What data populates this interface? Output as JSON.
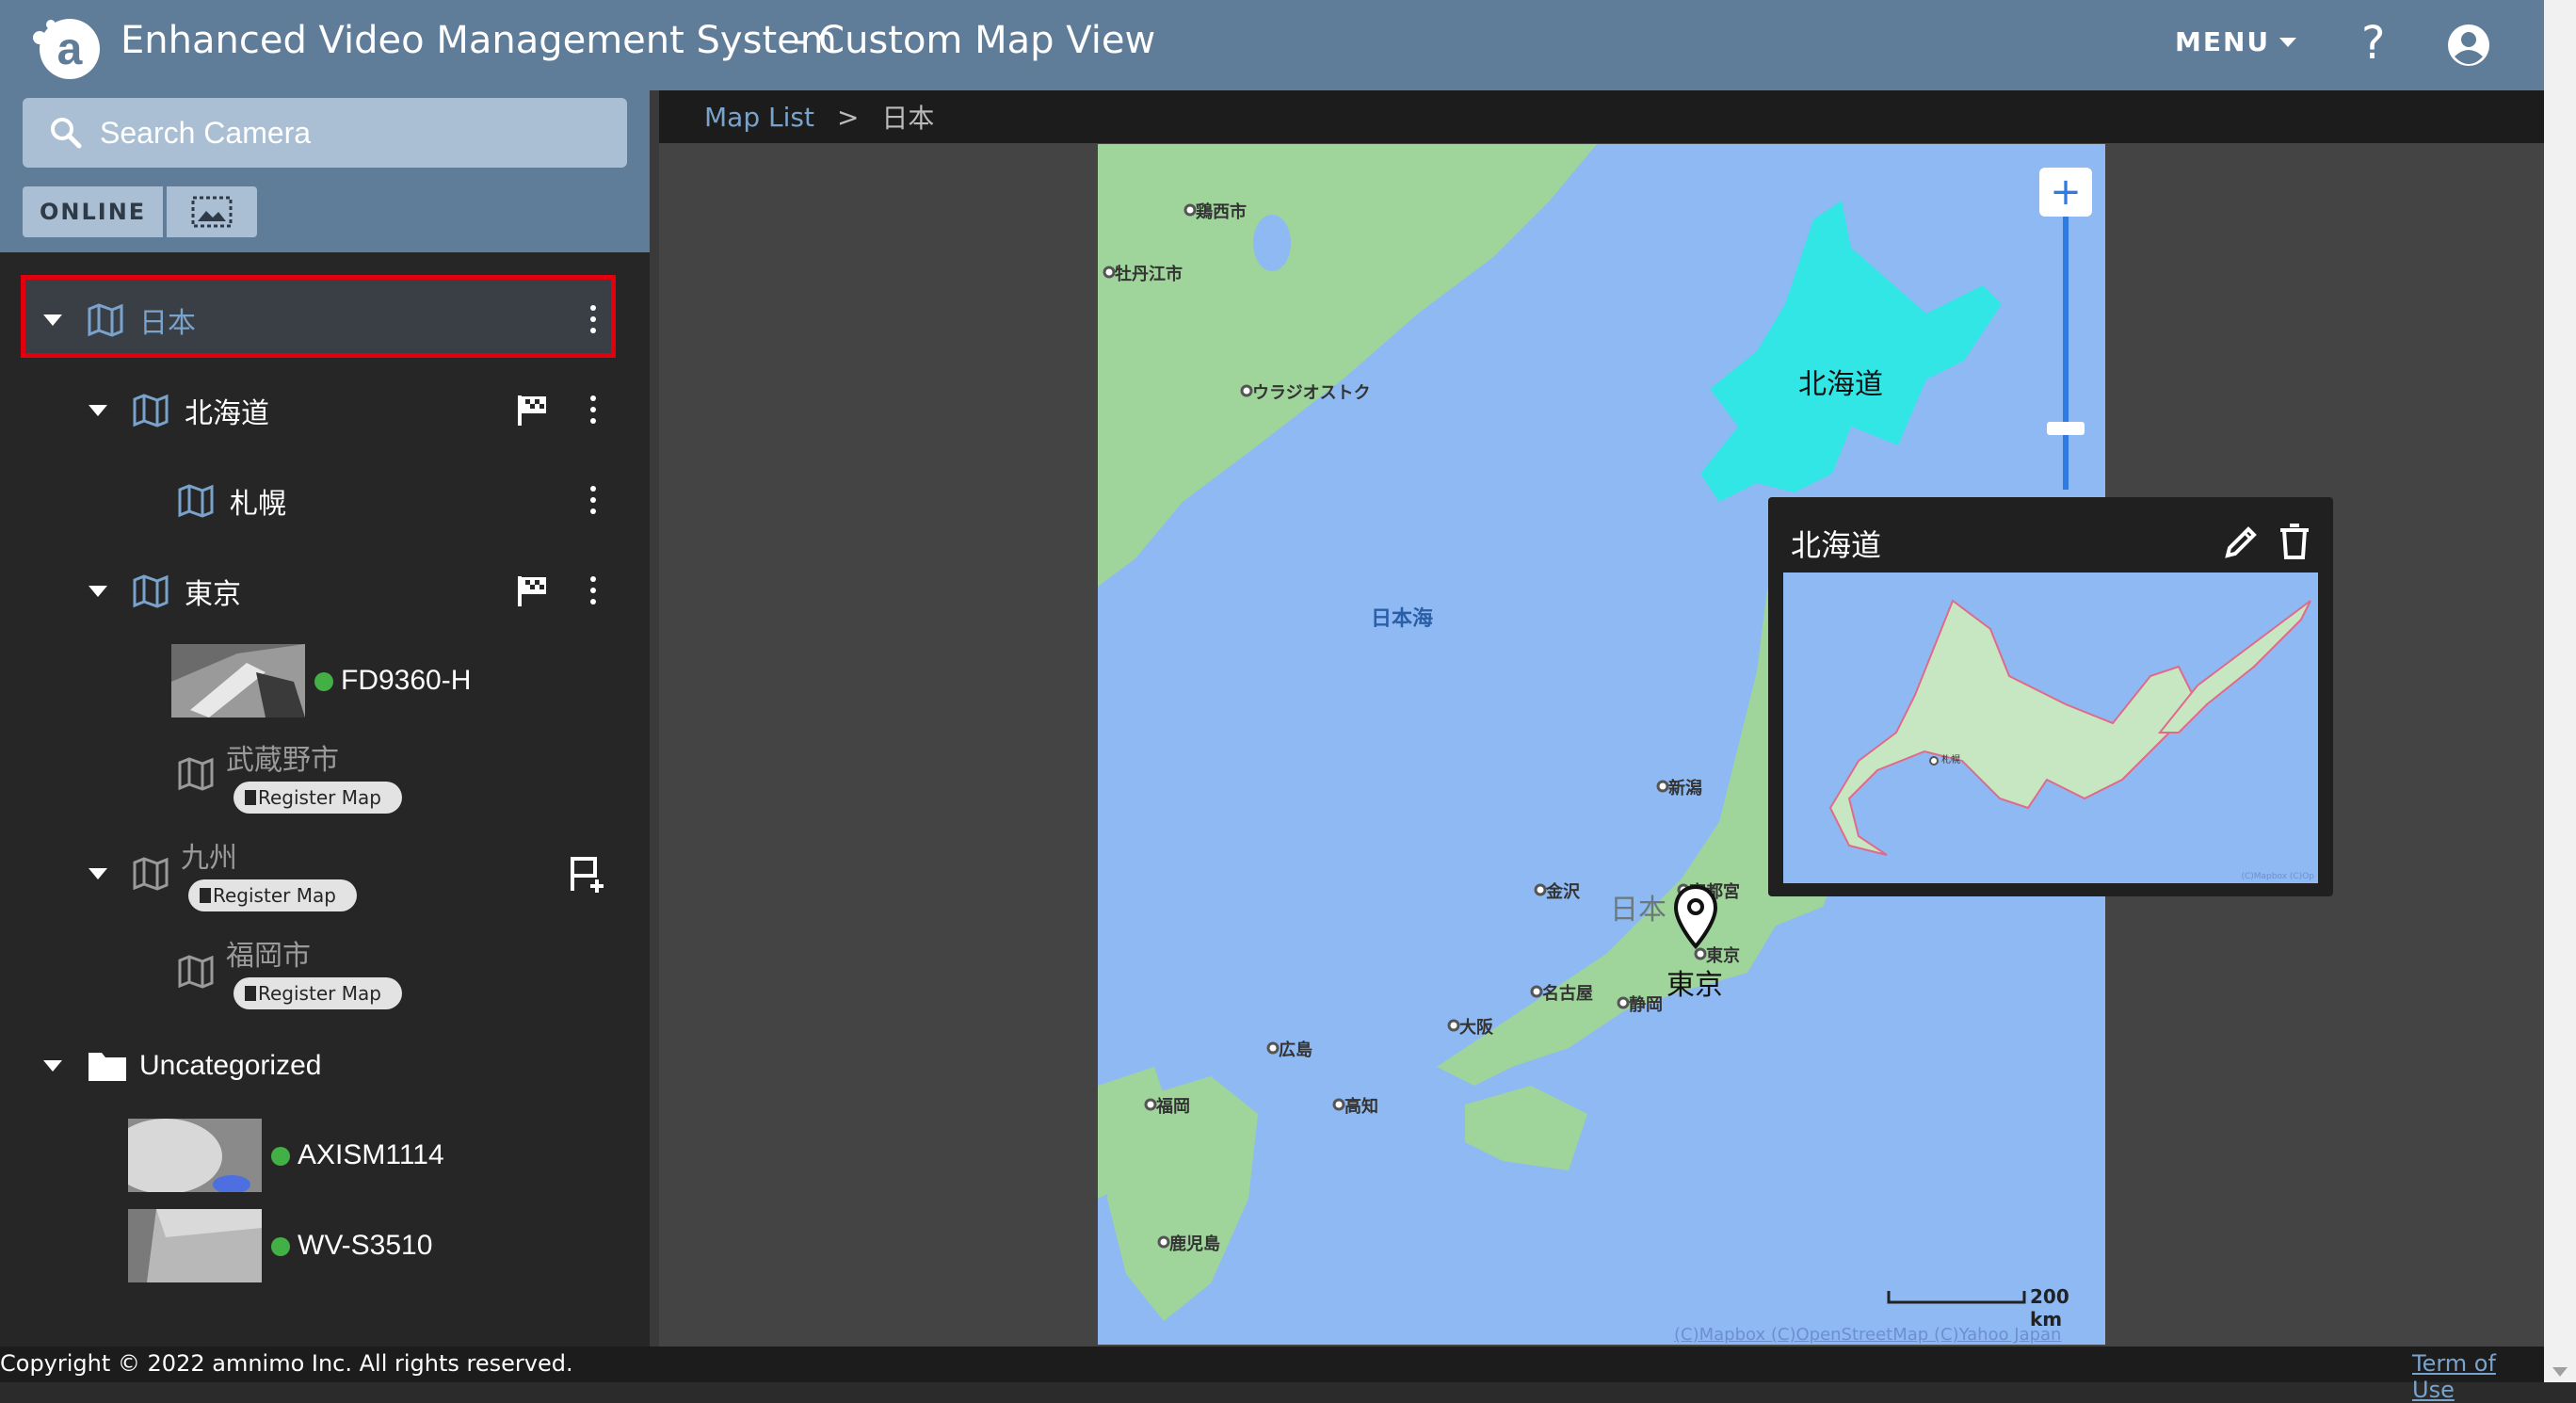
{
  "header": {
    "app_title": "Enhanced Video Management System",
    "sub_title": "- Custom Map View",
    "menu_label": "MENU",
    "help_label": "?"
  },
  "search": {
    "placeholder": "Search Camera"
  },
  "filters": {
    "online_label": "ONLINE"
  },
  "tree": {
    "root": {
      "label": "日本"
    },
    "hokkaido": {
      "label": "北海道"
    },
    "sapporo": {
      "label": "札幌"
    },
    "tokyo": {
      "label": "東京"
    },
    "camera_fd": {
      "label": "FD9360-H",
      "status": "online"
    },
    "musashino": {
      "label": "武蔵野市",
      "register": "Register Map"
    },
    "kyushu": {
      "label": "九州",
      "register": "Register Map"
    },
    "fukuoka": {
      "label": "福岡市",
      "register": "Register Map"
    },
    "uncategorized": {
      "label": "Uncategorized"
    },
    "camera_axis": {
      "label": "AXISM1114",
      "status": "online"
    },
    "camera_wv": {
      "label": "WV-S3510",
      "status": "online"
    }
  },
  "breadcrumb": {
    "link": "Map List",
    "separator": ">",
    "current": "日本"
  },
  "map": {
    "labels": {
      "hokkaido": "北海道",
      "nihonkai": "日本海",
      "nihon": "日本",
      "tokyo_marker": "東京",
      "cities": [
        "鶏西市",
        "牡丹江市",
        "ウラジオストク",
        "新潟",
        "金沢",
        "宇都宮",
        "東京",
        "名古屋",
        "静岡",
        "大阪",
        "広島",
        "高知",
        "福岡",
        "鹿児島"
      ]
    },
    "scale": "200 km",
    "attribution": "(C)Mapbox (C)OpenStreetMap (C)Yahoo Japan"
  },
  "popup": {
    "title": "北海道",
    "mini_label": "札幌",
    "mini_attrib": "(C)Mapbox (C)Op"
  },
  "footer": {
    "copyright": "Copyright © 2022 amnimo Inc. All rights reserved.",
    "terms": "Term of Use"
  },
  "colors": {
    "header": "#5f7c99",
    "sidebar": "#262626",
    "selection": "#e0000e",
    "online": "#43b046",
    "map_water": "#8fb9f2",
    "highlight": "#33e6e6"
  }
}
